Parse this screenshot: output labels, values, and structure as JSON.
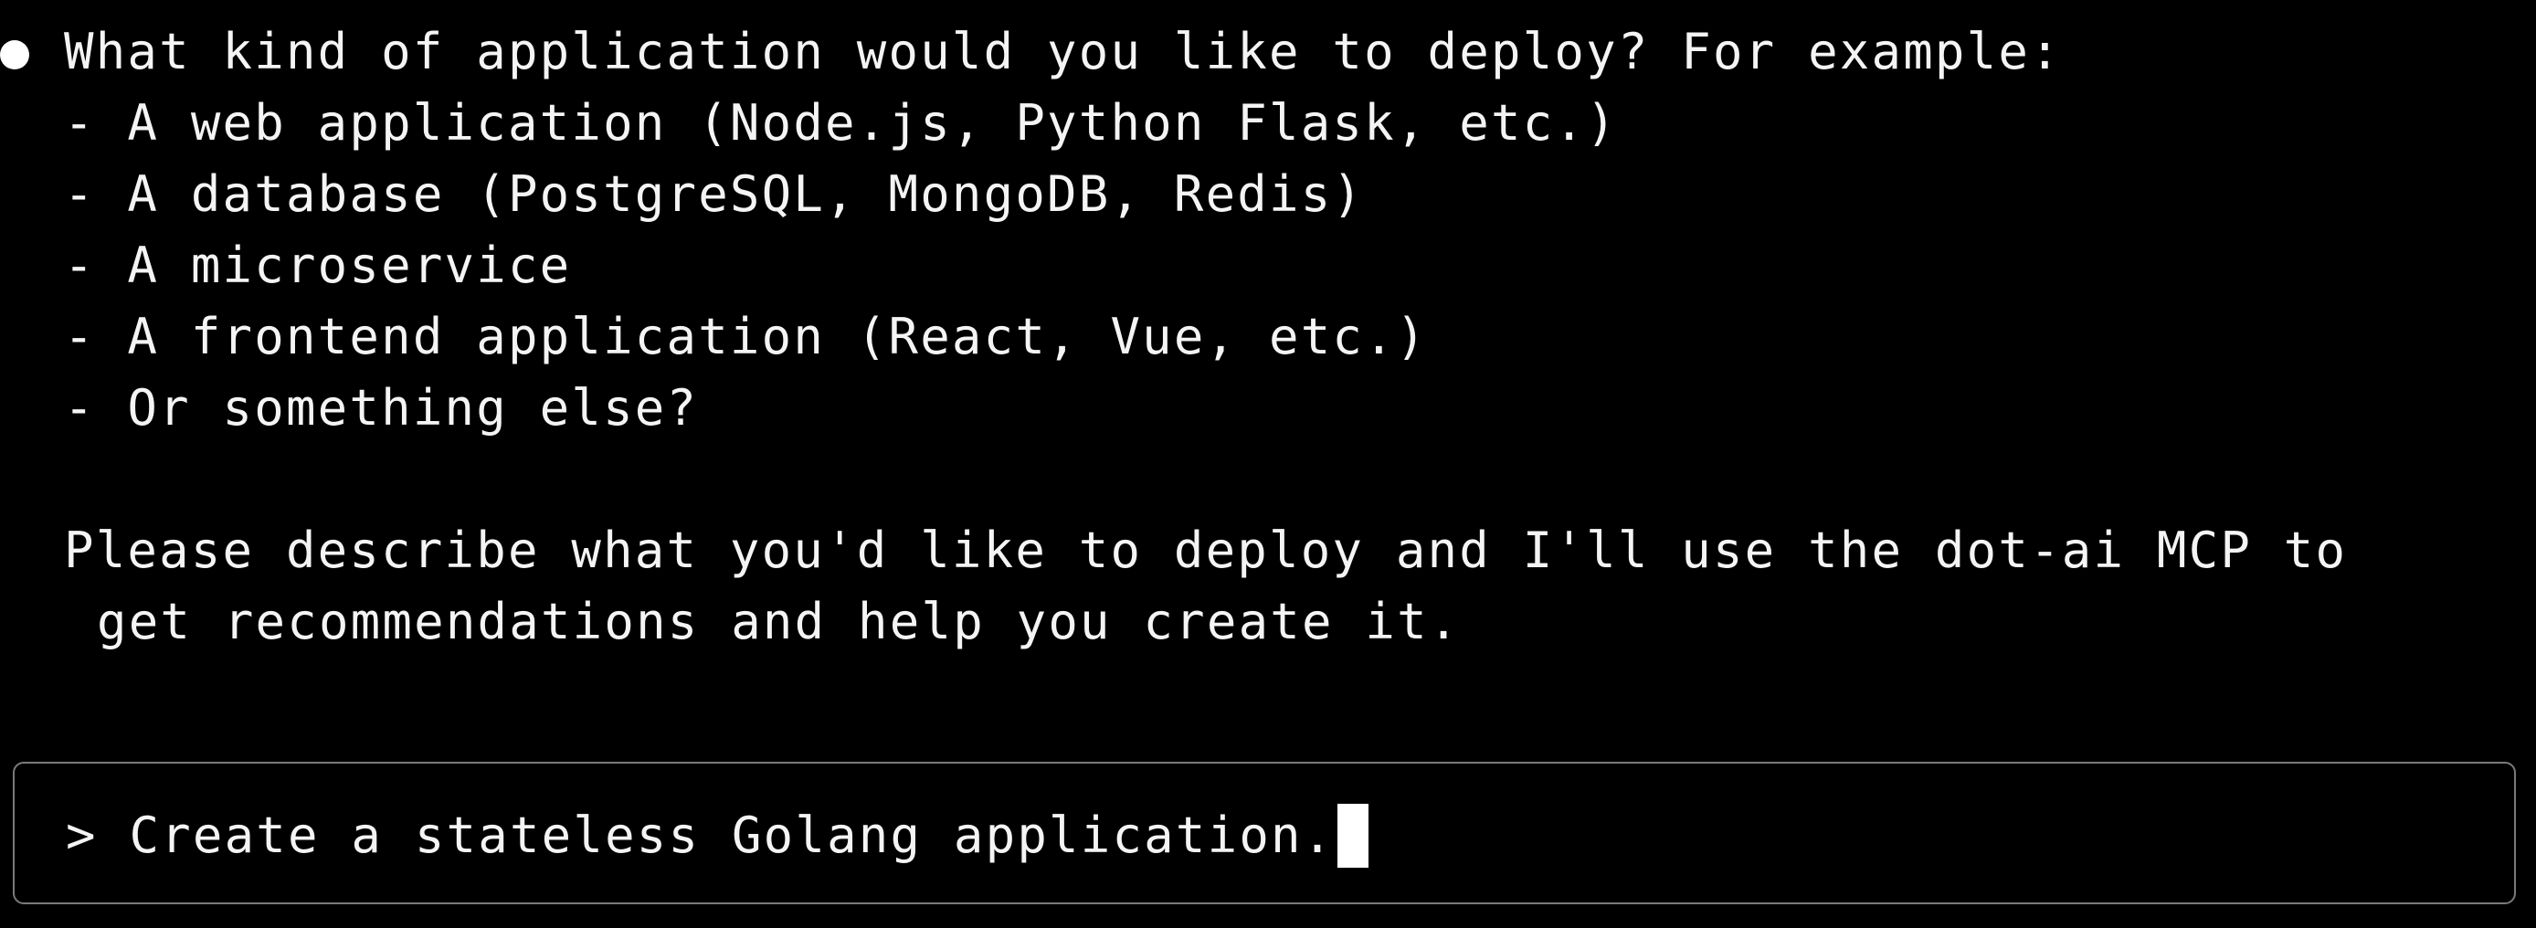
{
  "assistant_message": {
    "lines": [
      "What kind of application would you like to deploy? For example:",
      "- A web application (Node.js, Python Flask, etc.)",
      "- A database (PostgreSQL, MongoDB, Redis)",
      "- A microservice",
      "- A frontend application (React, Vue, etc.)",
      "- Or something else?",
      "Please describe what you'd like to deploy and I'll use the dot-ai MCP to",
      "get recommendations and help you create it."
    ]
  },
  "input": {
    "prompt_symbol": ">",
    "value": "Create a stateless Golang application."
  }
}
